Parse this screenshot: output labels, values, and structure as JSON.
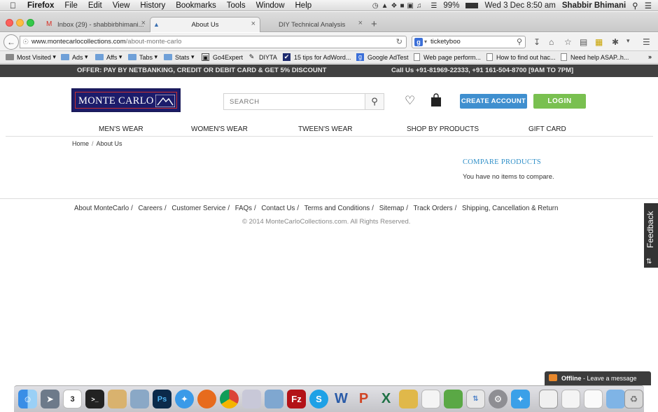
{
  "menubar": {
    "apple": "",
    "app": "Firefox",
    "items": [
      "File",
      "Edit",
      "View",
      "History",
      "Bookmarks",
      "Tools",
      "Window",
      "Help"
    ],
    "battery": "99%",
    "datetime": "Wed 3 Dec  8:50 am",
    "user": "Shabbir Bhimani"
  },
  "tabs": [
    {
      "label": "Inbox (29) - shabbirbhimani...",
      "icon": "gmail-icon"
    },
    {
      "label": "About Us",
      "icon": "site-icon"
    },
    {
      "label": "DIY Technical Analysis",
      "icon": "none"
    }
  ],
  "navbar": {
    "url_host": "www.montecarlocollections.com",
    "url_path": "/about-monte-carlo",
    "search_value": "ticketyboo"
  },
  "bookmarks": [
    {
      "label": "Most Visited",
      "kind": "menu"
    },
    {
      "label": "Ads",
      "kind": "folder"
    },
    {
      "label": "Affs",
      "kind": "folder"
    },
    {
      "label": "Tabs",
      "kind": "folder"
    },
    {
      "label": "Stats",
      "kind": "folder"
    },
    {
      "label": "Go4Expert",
      "kind": "site"
    },
    {
      "label": "DIYTA",
      "kind": "site"
    },
    {
      "label": "15 tips for AdWord...",
      "kind": "site"
    },
    {
      "label": "Google AdTest",
      "kind": "site"
    },
    {
      "label": "Web page perform...",
      "kind": "page"
    },
    {
      "label": "How to find out hac...",
      "kind": "page"
    },
    {
      "label": "Need help ASAP..h...",
      "kind": "page"
    }
  ],
  "offer": {
    "left": "OFFER: PAY BY NETBANKING, CREDIT OR DEBIT CARD & GET 5% DISCOUNT",
    "right": "Call Us +91-81969-22333, +91 161-504-8700 [9AM TO 7PM]"
  },
  "header": {
    "logo_text": "MONTE CARLO",
    "search_placeholder": "SEARCH",
    "create_account": "CREATE ACCOUNT",
    "login": "LOGIN"
  },
  "nav": [
    "MEN'S WEAR",
    "WOMEN'S WEAR",
    "TWEEN'S WEAR",
    "SHOP BY PRODUCTS",
    "GIFT CARD"
  ],
  "breadcrumb": {
    "home": "Home",
    "sep": "/",
    "current": "About Us"
  },
  "compare": {
    "title": "COMPARE PRODUCTS",
    "text": "You have no items to compare."
  },
  "footer": {
    "links": [
      "About MonteCarlo",
      "Careers",
      "Customer Service",
      "FAQs",
      "Contact Us",
      "Terms and Conditions",
      "Sitemap",
      "Track Orders",
      "Shipping, Cancellation & Return"
    ],
    "separator": "/",
    "copyright": "© 2014 MonteCarloCollections.com. All Rights Reserved."
  },
  "feedback": {
    "label": "Feedback"
  },
  "chat": {
    "status": "Offline",
    "text": " - Leave a message"
  },
  "dock": {
    "calendar_day": "3"
  },
  "colors": {
    "offer_bar": "#414141",
    "create_account": "#3f8fcf",
    "login": "#79c050",
    "compare_title": "#2f8fc8"
  }
}
